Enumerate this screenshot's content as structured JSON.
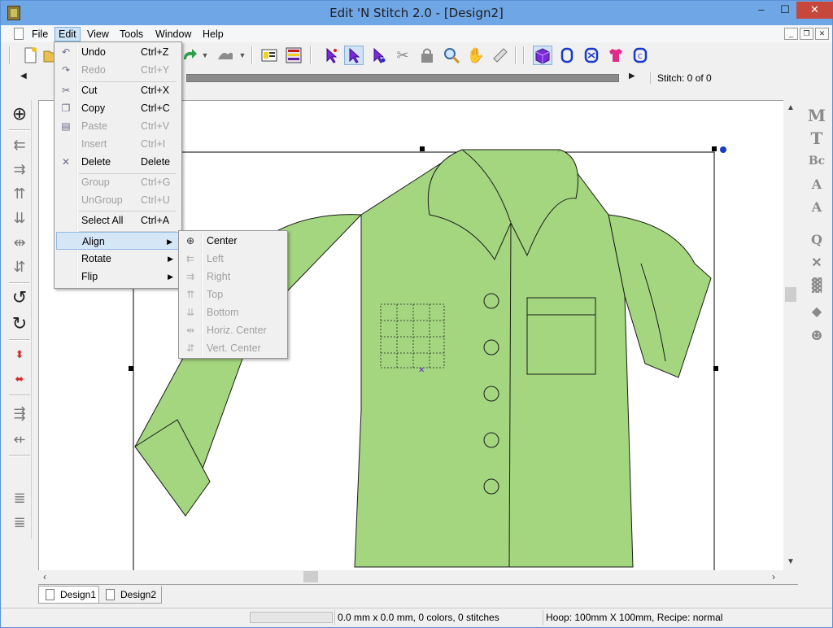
{
  "window": {
    "title": "Edit 'N Stitch 2.0 - [Design2]"
  },
  "titlebar_buttons": {
    "minimize": "–",
    "maximize": "☐",
    "close": "✕"
  },
  "menubar": [
    {
      "label": "File"
    },
    {
      "label": "Edit"
    },
    {
      "label": "View"
    },
    {
      "label": "Tools"
    },
    {
      "label": "Window"
    },
    {
      "label": "Help"
    }
  ],
  "mdi_buttons": {
    "minimize": "_",
    "restore": "❐",
    "close": "✕"
  },
  "stitch_status": "Stitch:   0 of 0",
  "edit_menu": {
    "items": [
      {
        "label": "Undo",
        "shortcut": "Ctrl+Z",
        "enabled": true,
        "icon": "undo-icon"
      },
      {
        "label": "Redo",
        "shortcut": "Ctrl+Y",
        "enabled": false,
        "icon": "redo-icon"
      },
      {
        "label": "Cut",
        "shortcut": "Ctrl+X",
        "enabled": true,
        "icon": "scissors-icon"
      },
      {
        "label": "Copy",
        "shortcut": "Ctrl+C",
        "enabled": true,
        "icon": "copy-icon"
      },
      {
        "label": "Paste",
        "shortcut": "Ctrl+V",
        "enabled": false,
        "icon": "paste-icon"
      },
      {
        "label": "Insert",
        "shortcut": "Ctrl+I",
        "enabled": false,
        "icon": ""
      },
      {
        "label": "Delete",
        "shortcut": "Delete",
        "enabled": true,
        "icon": "delete-icon"
      },
      {
        "label": "Group",
        "shortcut": "Ctrl+G",
        "enabled": false,
        "icon": ""
      },
      {
        "label": "UnGroup",
        "shortcut": "Ctrl+U",
        "enabled": false,
        "icon": ""
      },
      {
        "label": "Select All",
        "shortcut": "Ctrl+A",
        "enabled": true,
        "icon": ""
      },
      {
        "label": "Align",
        "shortcut": "",
        "enabled": true,
        "icon": "",
        "submenu": true
      },
      {
        "label": "Rotate",
        "shortcut": "",
        "enabled": true,
        "icon": "",
        "submenu": true
      },
      {
        "label": "Flip",
        "shortcut": "",
        "enabled": true,
        "icon": "",
        "submenu": true
      }
    ]
  },
  "align_menu": {
    "items": [
      {
        "label": "Center",
        "enabled": true,
        "icon": "crosshair-icon"
      },
      {
        "label": "Left",
        "enabled": false,
        "icon": "align-left-icon"
      },
      {
        "label": "Right",
        "enabled": false,
        "icon": "align-right-icon"
      },
      {
        "label": "Top",
        "enabled": false,
        "icon": "align-top-icon"
      },
      {
        "label": "Bottom",
        "enabled": false,
        "icon": "align-bottom-icon"
      },
      {
        "label": "Horiz. Center",
        "enabled": false,
        "icon": "horiz-center-icon"
      },
      {
        "label": "Vert. Center",
        "enabled": false,
        "icon": "vert-center-icon"
      }
    ]
  },
  "tabs": [
    {
      "label": "Design1",
      "active": false
    },
    {
      "label": "Design2",
      "active": true
    }
  ],
  "status": {
    "design_info": "0.0 mm x 0.0 mm, 0 colors, 0 stitches",
    "hoop_info": "Hoop: 100mm X 100mm, Recipe: normal"
  },
  "colors": {
    "shirt": "#a3d67f",
    "accent_blue": "#1a3ac8",
    "purple": "#8a2ad8"
  },
  "right_toolbar_glyphs": [
    "M",
    "T",
    "B",
    "A",
    "A",
    "Q",
    "✕",
    "▓",
    "◆",
    "☻"
  ],
  "left_toolbar_glyphs": [
    "⊕",
    "⇇",
    "⇉",
    "⇈",
    "⇊",
    "⇹",
    "⇵",
    "↺",
    "↻",
    "⬍",
    "⬌",
    "⇶",
    "⇷",
    "≣",
    "≣"
  ]
}
